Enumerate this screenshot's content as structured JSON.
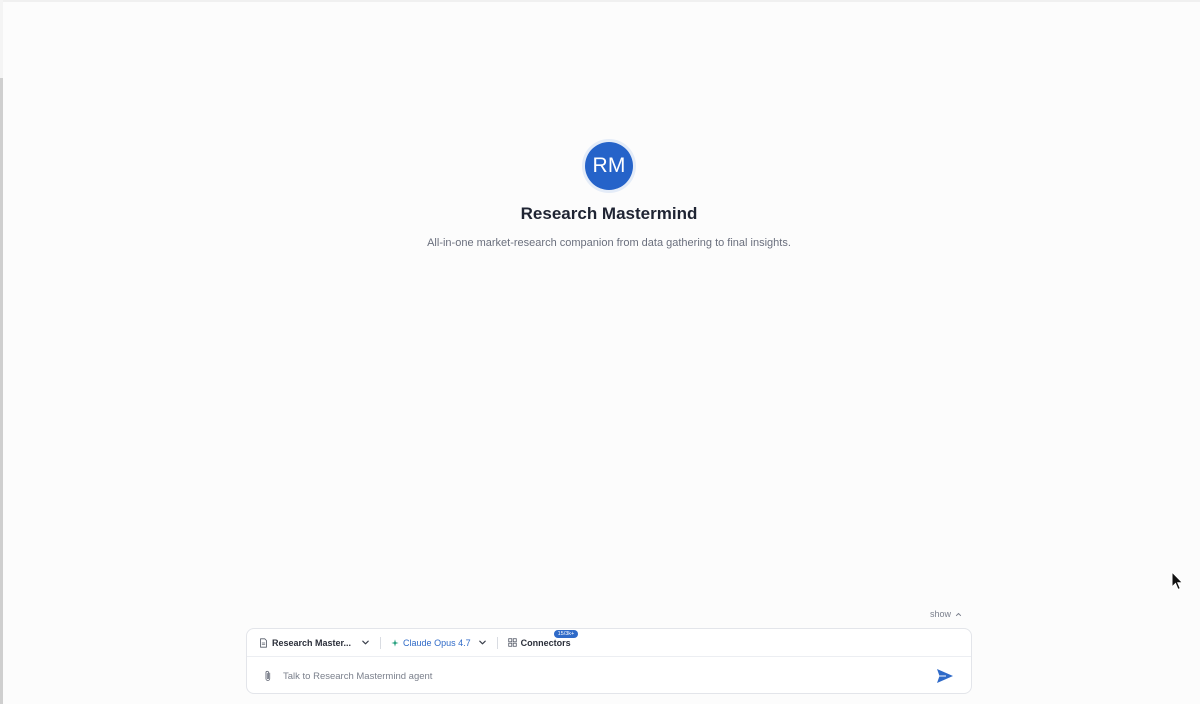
{
  "agent": {
    "avatar_initials": "RM",
    "name": "Research Mastermind",
    "description": "All-in-one market-research companion from data gathering to final insights."
  },
  "show_toggle": {
    "label": "show",
    "icon": "chevron-up-icon"
  },
  "composer": {
    "agent_select": {
      "icon": "document-icon",
      "label": "Research Master...",
      "chevron": "chevron-down-icon"
    },
    "model_select": {
      "icon": "sparkle-icon",
      "label": "Claude Opus 4.7",
      "chevron": "chevron-down-icon"
    },
    "connectors": {
      "icon": "grid-icon",
      "label": "Connectors",
      "badge": "15/3k+"
    },
    "input": {
      "placeholder": "Talk to Research Mastermind agent",
      "value": ""
    },
    "attach_icon": "paperclip-icon",
    "send_icon": "send-icon"
  },
  "colors": {
    "accent": "#2563c9",
    "model_text": "#2f6ac8",
    "page_background": "#fcfcfc"
  }
}
